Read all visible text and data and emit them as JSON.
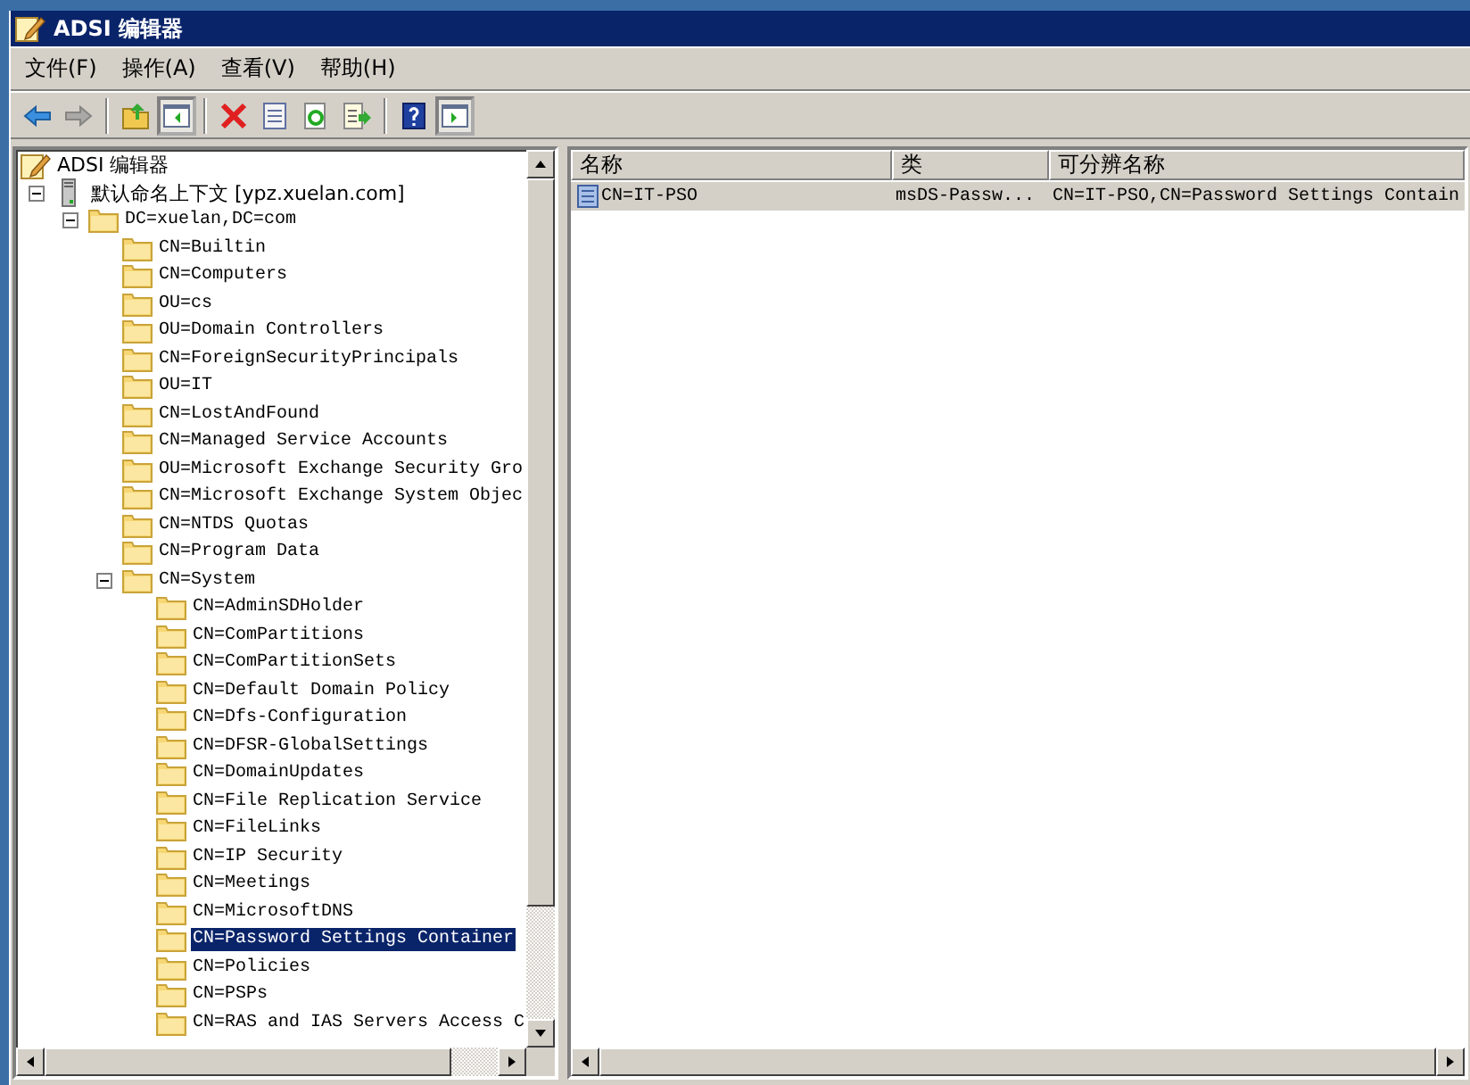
{
  "window": {
    "title": "ADSI 编辑器"
  },
  "menu": [
    "文件(F)",
    "操作(A)",
    "查看(V)",
    "帮助(H)"
  ],
  "toolbar": [
    {
      "kind": "back",
      "pressed": false,
      "disabled": false
    },
    {
      "kind": "forward",
      "pressed": false,
      "disabled": true
    },
    {
      "kind": "sep"
    },
    {
      "kind": "up",
      "pressed": false,
      "disabled": false
    },
    {
      "kind": "tree",
      "pressed": true,
      "disabled": false
    },
    {
      "kind": "sep"
    },
    {
      "kind": "delete",
      "pressed": false,
      "disabled": false
    },
    {
      "kind": "properties",
      "pressed": false,
      "disabled": false
    },
    {
      "kind": "refresh",
      "pressed": false,
      "disabled": false
    },
    {
      "kind": "export",
      "pressed": false,
      "disabled": false
    },
    {
      "kind": "sep"
    },
    {
      "kind": "help",
      "pressed": false,
      "disabled": false
    },
    {
      "kind": "action",
      "pressed": true,
      "disabled": false
    }
  ],
  "tree": {
    "root": {
      "label": "ADSI 编辑器",
      "kind": "root",
      "selected": false,
      "children": [
        {
          "label": "默认命名上下文 [ypz.xuelan.com]",
          "kind": "server",
          "expanded": true,
          "selected": false,
          "children": [
            {
              "label": "DC=xuelan,DC=com",
              "kind": "folder",
              "expanded": true,
              "selected": false,
              "children": [
                {
                  "label": "CN=Builtin",
                  "kind": "folder",
                  "selected": false
                },
                {
                  "label": "CN=Computers",
                  "kind": "folder",
                  "selected": false
                },
                {
                  "label": "OU=cs",
                  "kind": "folder",
                  "selected": false
                },
                {
                  "label": "OU=Domain Controllers",
                  "kind": "folder",
                  "selected": false
                },
                {
                  "label": "CN=ForeignSecurityPrincipals",
                  "kind": "folder",
                  "selected": false
                },
                {
                  "label": "OU=IT",
                  "kind": "folder",
                  "selected": false
                },
                {
                  "label": "CN=LostAndFound",
                  "kind": "folder",
                  "selected": false
                },
                {
                  "label": "CN=Managed Service Accounts",
                  "kind": "folder",
                  "selected": false
                },
                {
                  "label": "OU=Microsoft Exchange Security Gro",
                  "kind": "folder",
                  "selected": false
                },
                {
                  "label": "CN=Microsoft Exchange System Objec",
                  "kind": "folder",
                  "selected": false
                },
                {
                  "label": "CN=NTDS Quotas",
                  "kind": "folder",
                  "selected": false
                },
                {
                  "label": "CN=Program Data",
                  "kind": "folder",
                  "selected": false
                },
                {
                  "label": "CN=System",
                  "kind": "folder",
                  "expanded": true,
                  "selected": false,
                  "children": [
                    {
                      "label": "CN=AdminSDHolder",
                      "kind": "folder",
                      "selected": false
                    },
                    {
                      "label": "CN=ComPartitions",
                      "kind": "folder",
                      "selected": false
                    },
                    {
                      "label": "CN=ComPartitionSets",
                      "kind": "folder",
                      "selected": false
                    },
                    {
                      "label": "CN=Default Domain Policy",
                      "kind": "folder",
                      "selected": false
                    },
                    {
                      "label": "CN=Dfs-Configuration",
                      "kind": "folder",
                      "selected": false
                    },
                    {
                      "label": "CN=DFSR-GlobalSettings",
                      "kind": "folder",
                      "selected": false
                    },
                    {
                      "label": "CN=DomainUpdates",
                      "kind": "folder",
                      "selected": false
                    },
                    {
                      "label": "CN=File Replication Service",
                      "kind": "folder",
                      "selected": false
                    },
                    {
                      "label": "CN=FileLinks",
                      "kind": "folder",
                      "selected": false
                    },
                    {
                      "label": "CN=IP Security",
                      "kind": "folder",
                      "selected": false
                    },
                    {
                      "label": "CN=Meetings",
                      "kind": "folder",
                      "selected": false
                    },
                    {
                      "label": "CN=MicrosoftDNS",
                      "kind": "folder",
                      "selected": false
                    },
                    {
                      "label": "CN=Password Settings Container",
                      "kind": "folder",
                      "selected": true
                    },
                    {
                      "label": "CN=Policies",
                      "kind": "folder",
                      "selected": false
                    },
                    {
                      "label": "CN=PSPs",
                      "kind": "folder",
                      "selected": false
                    },
                    {
                      "label": "CN=RAS and IAS Servers Access C",
                      "kind": "folder",
                      "selected": false
                    }
                  ]
                }
              ]
            }
          ]
        }
      ]
    }
  },
  "list": {
    "columns": [
      "名称",
      "类",
      "可分辨名称"
    ],
    "rows": [
      {
        "cells": [
          "CN=IT-PSO",
          "msDS-Passw...",
          "CN=IT-PSO,CN=Password Settings Contain"
        ],
        "selected": true
      }
    ]
  }
}
